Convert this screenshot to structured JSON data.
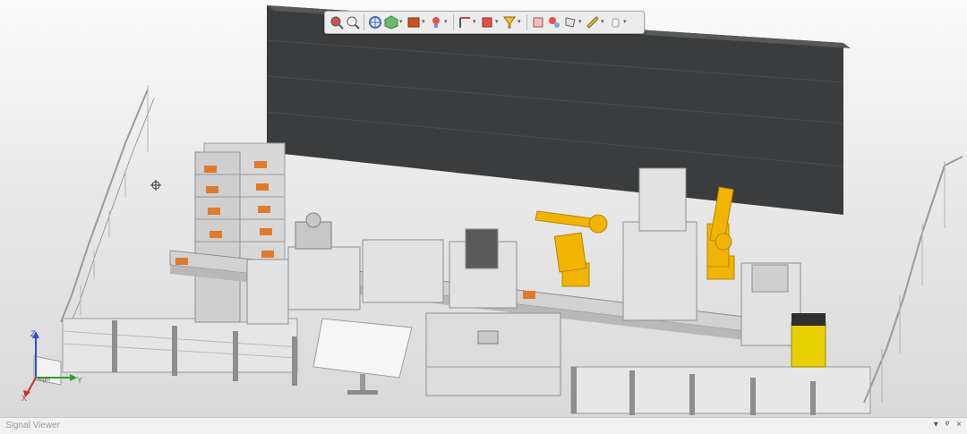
{
  "viewport": {
    "name": "3D production line viewport"
  },
  "toolbar": {
    "buttons": [
      {
        "name": "zoom-to-fit-icon"
      },
      {
        "name": "zoom-window-icon"
      },
      {
        "name": "pan-icon"
      },
      {
        "name": "view-orientation-icon"
      },
      {
        "name": "render-style-icon"
      },
      {
        "name": "light-icon"
      },
      {
        "name": "robot-frame-icon"
      },
      {
        "name": "section-box-icon"
      },
      {
        "name": "filter-icon"
      },
      {
        "name": "measure-icon"
      },
      {
        "name": "snap-icon"
      },
      {
        "name": "select-component-icon"
      },
      {
        "name": "ruler-icon"
      },
      {
        "name": "hand-icon"
      }
    ]
  },
  "triad": {
    "x_label": "Y",
    "z_label": "Z",
    "x_axis_label": "X",
    "face_label": "Right"
  },
  "signal_viewer": {
    "title": "Signal Viewer",
    "controls": {
      "menu": "▾",
      "pin": "ᵠ",
      "close": "×"
    }
  },
  "colors": {
    "robot": "#f1b400",
    "pallet": "#e07a2a",
    "wall": "#3a3b3c",
    "agv": "#e8d000"
  }
}
